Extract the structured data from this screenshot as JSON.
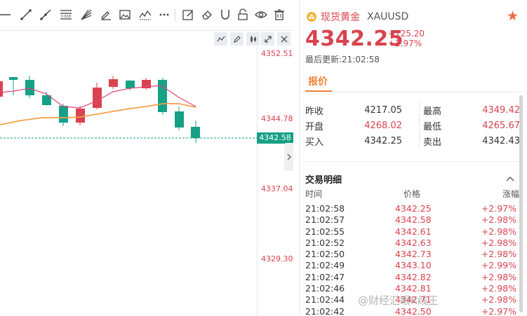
{
  "toolbar": {
    "tools": [
      "line-tool-icon",
      "trend-line-icon",
      "ray-icon",
      "fib-retracement-icon",
      "gann-fan-icon",
      "brush-icon",
      "image-icon",
      "pattern-icon",
      "more-icon",
      "note-icon",
      "eraser-icon",
      "magnet-icon",
      "lock-icon",
      "eye-icon",
      "trash-icon"
    ],
    "fib_label": "0.618"
  },
  "chart": {
    "price_ticks": [
      "4352.51",
      "4344.78",
      "4337.04",
      "4329.30"
    ],
    "current_price": "4342.58"
  },
  "panel": {
    "symbol_name": "现货黄金",
    "symbol_code": "XAUUSD",
    "price": "4342.25",
    "change": "+125.20",
    "change_pct": "+2.97%",
    "last_update": "最后更新:21:02:58",
    "tab_label": "报价",
    "quote_left": [
      {
        "label": "昨收",
        "value": "4217.05",
        "color": "#333333"
      },
      {
        "label": "开盘",
        "value": "4268.02",
        "color": "#d9434f"
      },
      {
        "label": "买入",
        "value": "4342.25",
        "color": "#333333"
      }
    ],
    "quote_right": [
      {
        "label": "最高",
        "value": "4349.42",
        "color": "#d9434f"
      },
      {
        "label": "最低",
        "value": "4265.67",
        "color": "#d9434f"
      },
      {
        "label": "卖出",
        "value": "4342.43",
        "color": "#333333"
      }
    ],
    "deals_title": "交易明细",
    "deals_header": {
      "time": "时间",
      "price": "价格",
      "change": "涨幅"
    },
    "deals": [
      {
        "time": "21:02:58",
        "price": "4342.25",
        "change": "+2.97%"
      },
      {
        "time": "21:02:57",
        "price": "4342.58",
        "change": "+2.98%"
      },
      {
        "time": "21:02:55",
        "price": "4342.61",
        "change": "+2.98%"
      },
      {
        "time": "21:02:52",
        "price": "4342.63",
        "change": "+2.98%"
      },
      {
        "time": "21:02:50",
        "price": "4342.73",
        "change": "+2.98%"
      },
      {
        "time": "21:02:49",
        "price": "4343.10",
        "change": "+2.99%"
      },
      {
        "time": "21:02:47",
        "price": "4342.82",
        "change": "+2.98%"
      },
      {
        "time": "21:02:46",
        "price": "4342.81",
        "change": "+2.98%"
      },
      {
        "time": "21:02:44",
        "price": "4342.71",
        "change": "+2.98%"
      },
      {
        "time": "21:02:42",
        "price": "4342.50",
        "change": "+2.97%"
      }
    ]
  },
  "watermark": "@财经汇眼K线王",
  "colors": {
    "up": "#d9434f",
    "down": "#16a085",
    "accent": "#f0833a",
    "ma_pink": "#e0457b",
    "ma_orange": "#f5a04a"
  }
}
